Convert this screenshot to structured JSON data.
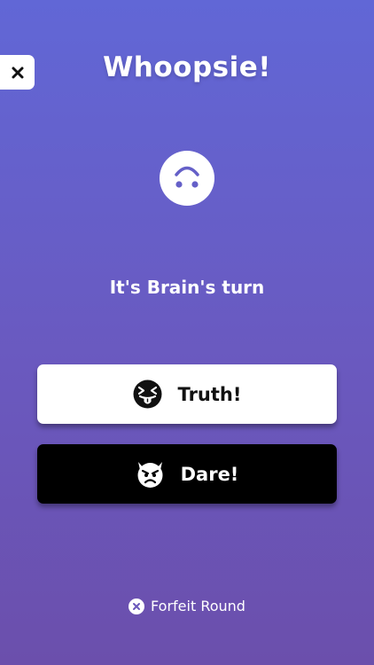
{
  "header": {
    "title": "Whoopsie!",
    "close_icon": "close-icon"
  },
  "status": {
    "face_icon": "upside-down-face-icon",
    "turn_text": "It's Brain's turn"
  },
  "choices": {
    "truth": {
      "label": "Truth!",
      "icon": "tongue-out-face-icon"
    },
    "dare": {
      "label": "Dare!",
      "icon": "devil-face-icon"
    }
  },
  "footer": {
    "forfeit_label": "Forfeit Round",
    "forfeit_icon": "close-circle-icon"
  },
  "colors": {
    "background_top": "#6167d6",
    "background_bottom": "#6b4fac",
    "truth_button": "#ffffff",
    "dare_button": "#000000",
    "text": "#ffffff"
  }
}
